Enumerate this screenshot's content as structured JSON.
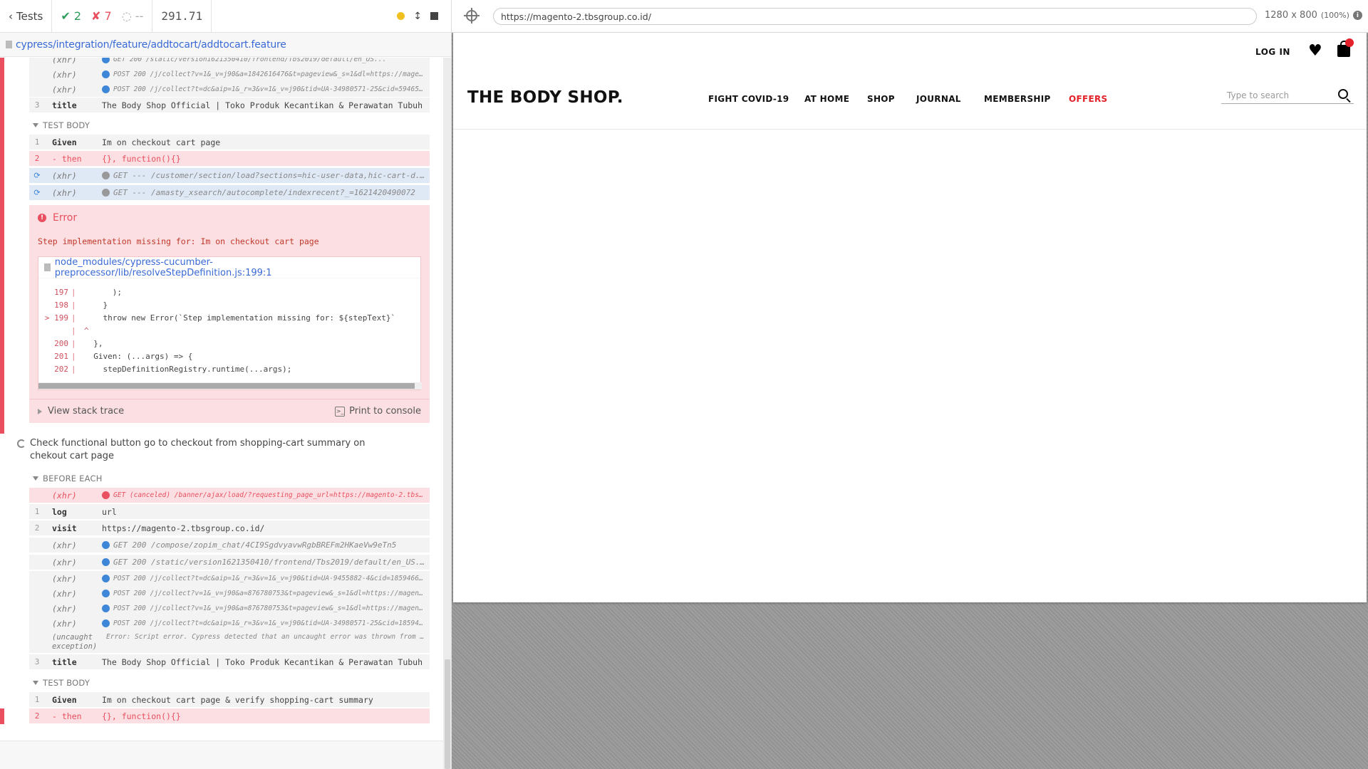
{
  "header": {
    "tests_label": "Tests",
    "passed": "2",
    "failed": "7",
    "pending": "--",
    "duration": "291.71"
  },
  "spec_path": "cypress/integration/feature/addtocart/addtocart.feature",
  "test1": {
    "top_xhr": [
      {
        "name": "(xhr)",
        "msg": "GET 200 /static/version1621350410/frontend/Tbs2019/default/en_US..."
      },
      {
        "name": "(xhr)",
        "msg": "POST 200 /j/collect?v=1&_v=j90&a=1842616476&t=pageview&_s=1&dl=https://magen..."
      },
      {
        "name": "(xhr)",
        "msg": "POST 200 /j/collect?t=dc&aip=1&_r=3&v=1&_v=j90&tid=UA-34980571-25&cid=594654..."
      }
    ],
    "title_cmd": {
      "num": "3",
      "name": "title",
      "msg": "The Body Shop Official | Toko Produk Kecantikan & Perawatan Tubuh"
    },
    "test_body_label": "TEST BODY",
    "steps": [
      {
        "num": "1",
        "name": "Given",
        "msg": "Im on checkout cart page"
      },
      {
        "num": "2",
        "name": "- then",
        "msg": "{}, function(){}"
      }
    ],
    "pending_xhr": [
      {
        "name": "(xhr)",
        "msg": "GET --- /customer/section/load?sections=hic-user-data,hic-cart-d..."
      },
      {
        "name": "(xhr)",
        "msg": "GET --- /amasty_xsearch/autocomplete/indexrecent?_=1621420490072"
      }
    ],
    "error": {
      "title": "Error",
      "message": "Step implementation missing for: Im on checkout cart page",
      "file": "node_modules/cypress-cucumber-preprocessor/lib/resolveStepDefinition.js:199:1",
      "code": [
        {
          "ln": "197",
          "text": "      );"
        },
        {
          "ln": "198",
          "text": "    }"
        },
        {
          "ln": "> 199",
          "text": "    throw new Error(`Step implementation missing for: ${stepText}`"
        },
        {
          "ln": "",
          "text": "^"
        },
        {
          "ln": "200",
          "text": "  },"
        },
        {
          "ln": "201",
          "text": "  Given: (...args) => {"
        },
        {
          "ln": "202",
          "text": "    stepDefinitionRegistry.runtime(...args);"
        }
      ],
      "view_stack": "View stack trace",
      "print_console": "Print to console"
    }
  },
  "test2": {
    "title": "Check functional button go to checkout from shopping-cart summary on chekout cart page",
    "before_each_label": "BEFORE EACH",
    "before_each": [
      {
        "num": "",
        "name": "(xhr)",
        "msg": "GET (canceled) /banner/ajax/load/?requesting_page_url=https://magento-2.tbsg..."
      },
      {
        "num": "1",
        "name": "log",
        "msg": "url"
      },
      {
        "num": "2",
        "name": "visit",
        "msg": "https://magento-2.tbsgroup.co.id/"
      },
      {
        "num": "",
        "name": "(xhr)",
        "msg": "GET 200 /compose/zopim_chat/4CI9SgdvyavwRgbBREFm2HKaeVw9eTn5"
      },
      {
        "num": "",
        "name": "(xhr)",
        "msg": "GET 200 /static/version1621350410/frontend/Tbs2019/default/en_US..."
      },
      {
        "num": "",
        "name": "(xhr)",
        "msg": "POST 200 /j/collect?t=dc&aip=1&_r=3&v=1&_v=j90&tid=UA-9455882-4&cid=18594665..."
      },
      {
        "num": "",
        "name": "(xhr)",
        "msg": "POST 200 /j/collect?v=1&_v=j90&a=876780753&t=pageview&_s=1&dl=https://magent..."
      },
      {
        "num": "",
        "name": "(xhr)",
        "msg": "POST 200 /j/collect?v=1&_v=j90&a=876780753&t=pageview&_s=1&dl=https://magent..."
      },
      {
        "num": "",
        "name": "(xhr)",
        "msg": "POST 200 /j/collect?t=dc&aip=1&_r=3&v=1&_v=j90&tid=UA-34980571-25&cid=185946..."
      },
      {
        "num": "",
        "name": "(uncaught exception)",
        "msg": "Error: Script error. Cypress detected that an uncaught error was thrown from ..."
      },
      {
        "num": "3",
        "name": "title",
        "msg": "The Body Shop Official | Toko Produk Kecantikan & Perawatan Tubuh"
      }
    ],
    "test_body_label": "TEST BODY",
    "steps": [
      {
        "num": "1",
        "name": "Given",
        "msg": "Im on checkout cart page & verify shopping-cart summary"
      },
      {
        "num": "2",
        "name": "- then",
        "msg": "{}, function(){}"
      }
    ]
  },
  "aut": {
    "url": "https://magento-2.tbsgroup.co.id/",
    "viewport": "1280 x 800",
    "scale": "(100%)",
    "site": {
      "login": "LOG IN",
      "logo": "THE BODY SHOP.",
      "nav": [
        "FIGHT COVID-19",
        "AT HOME",
        "SHOP",
        "JOURNAL",
        "MEMBERSHIP",
        "OFFERS"
      ],
      "search_placeholder": "Type to search"
    }
  },
  "colors": {
    "pass": "#2e9c5b",
    "fail": "#e94f5f",
    "link": "#3a6ad6",
    "offer": "#e4202a"
  }
}
